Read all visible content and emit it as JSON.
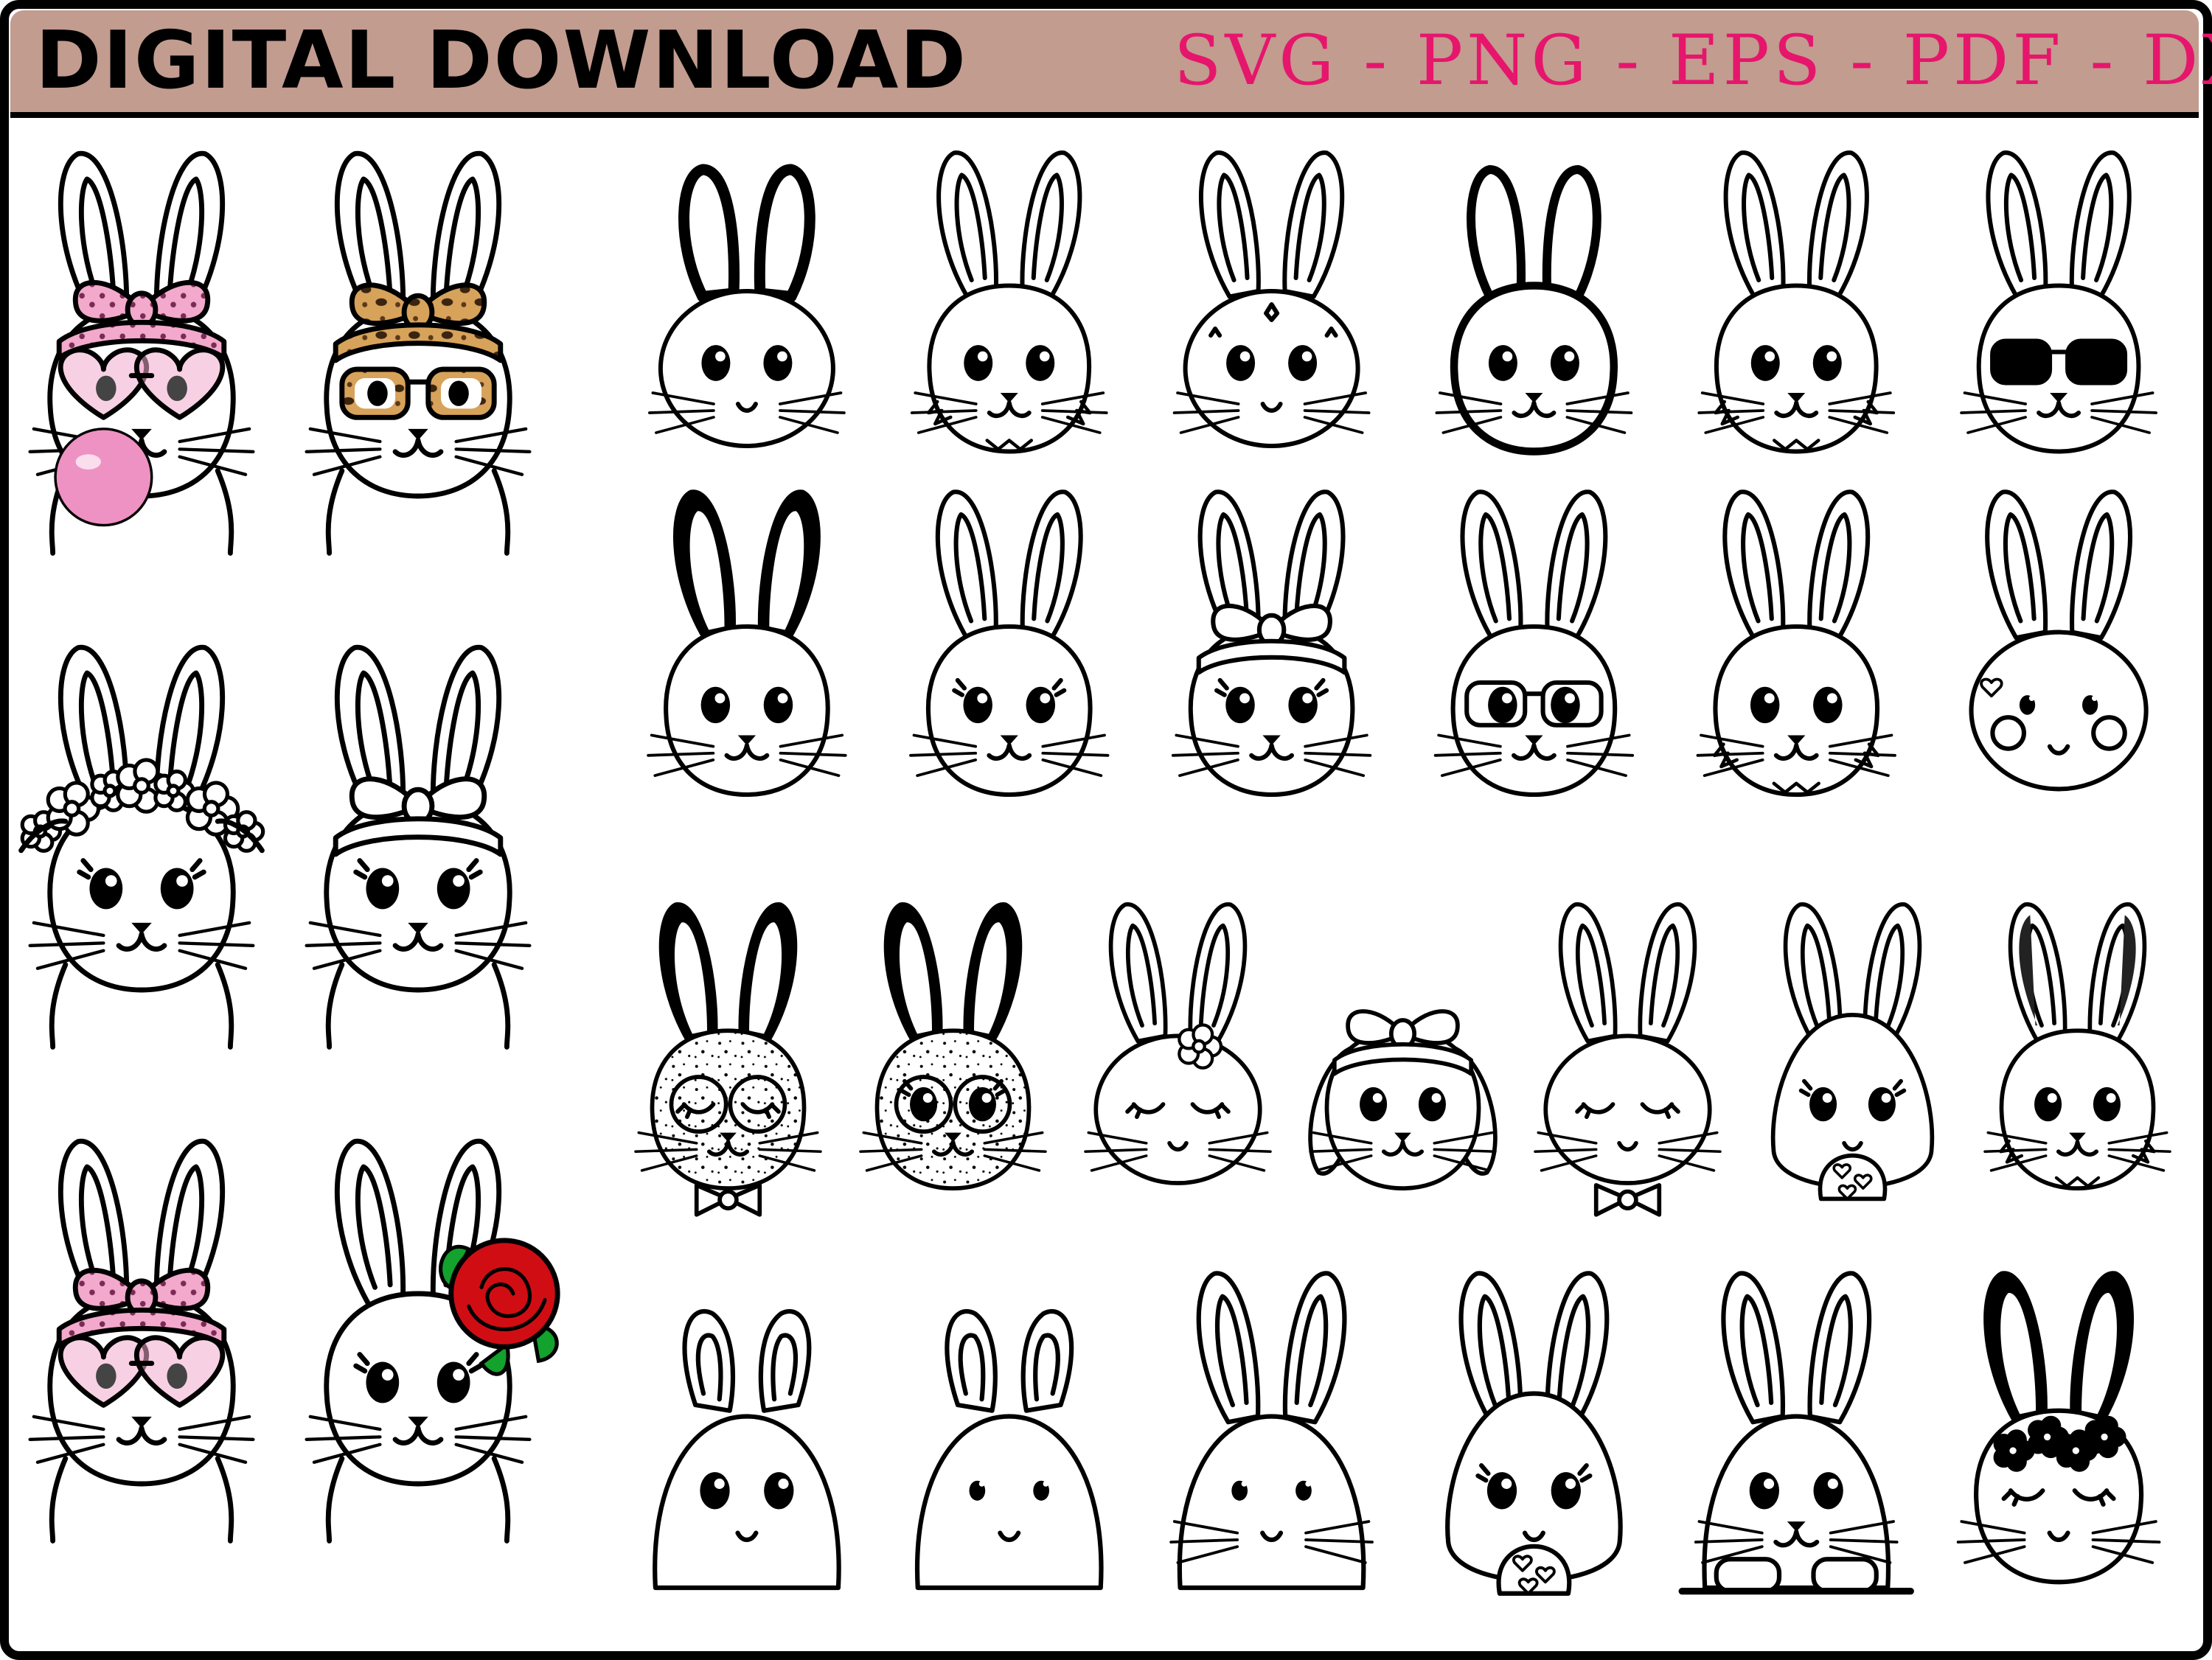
{
  "header": {
    "title": "DIGITAL DOWNLOAD",
    "formats": "SVG - PNG - EPS - PDF - DXF"
  },
  "colors": {
    "banner": "#c29c8f",
    "formats_text": "#e6166c",
    "pink_accessory": "#f2a9cc",
    "bubble_gum": "#ee91c3",
    "leopard": "#d7a25a",
    "rose": "#d10d14",
    "leaves": "#12a22d",
    "outline": "#000000"
  },
  "collection": {
    "accessory_bunnies": [
      {
        "accessory": "pink-bandana-heart-glasses-bubblegum"
      },
      {
        "accessory": "leopard-bandana-glasses"
      },
      {
        "accessory": "flower-crown"
      },
      {
        "accessory": "bandana"
      },
      {
        "accessory": "pink-bandana-heart-glasses"
      },
      {
        "accessory": "red-rose"
      }
    ],
    "rows": [
      [
        {
          "style": "round-cartoon"
        },
        {
          "style": "sketched"
        },
        {
          "style": "kawaii-sparkle"
        },
        {
          "style": "bold-outline"
        },
        {
          "style": "fluffy"
        },
        {
          "style": "sunglasses"
        }
      ],
      [
        {
          "style": "dark-ears"
        },
        {
          "style": "cute-lashes"
        },
        {
          "style": "bandana-sketched"
        },
        {
          "style": "glasses"
        },
        {
          "style": "smiling"
        },
        {
          "style": "hearts"
        }
      ],
      [
        {
          "style": "speckled-bowtie"
        },
        {
          "style": "speckled-lashes"
        },
        {
          "style": "flower-sleepy"
        },
        {
          "style": "lop-ear-bow"
        },
        {
          "style": "sleepy-bowtie"
        },
        {
          "style": "egg-hearts"
        },
        {
          "style": "realistic"
        }
      ],
      [
        {
          "style": "peek-small"
        },
        {
          "style": "peek-rounded"
        },
        {
          "style": "peek-tall-ears"
        },
        {
          "style": "egg-large"
        },
        {
          "style": "peeking-paws"
        },
        {
          "style": "flower-lashes"
        }
      ]
    ]
  }
}
